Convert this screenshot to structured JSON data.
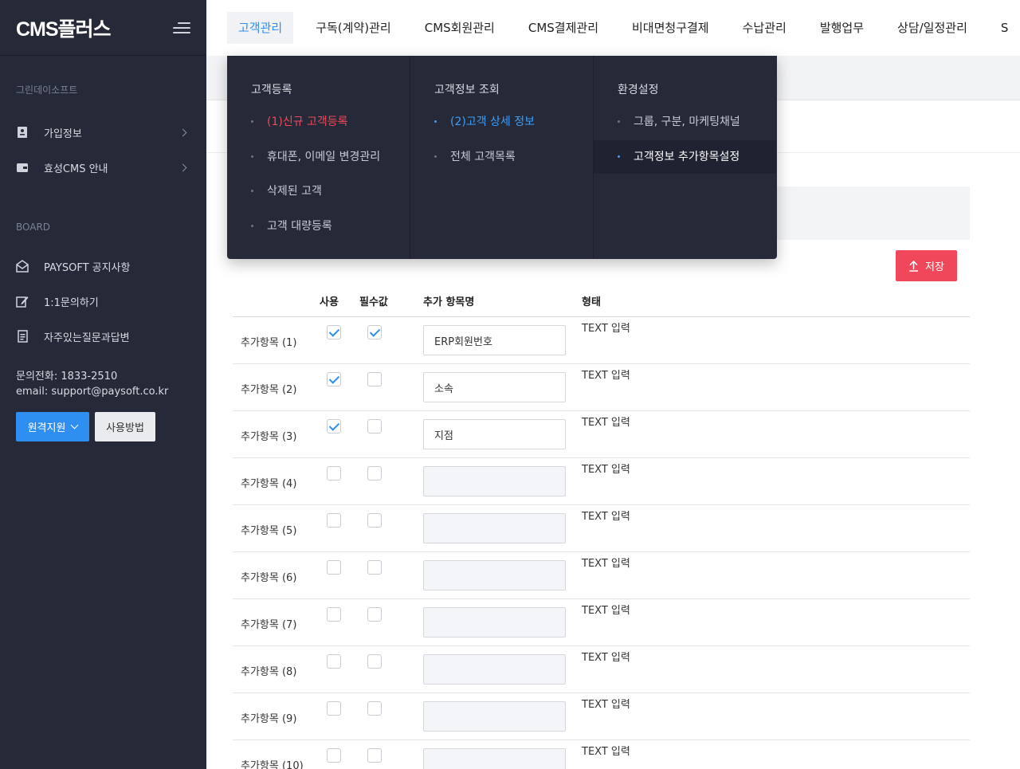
{
  "logo": "CMS플러스",
  "sidebar": {
    "company": "그린데이소프트",
    "menu": [
      {
        "label": "가입정보",
        "icon": "id-card-icon"
      },
      {
        "label": "효성CMS 안내",
        "icon": "wallet-icon"
      }
    ],
    "board_label": "BOARD",
    "board": [
      {
        "label": "PAYSOFT 공지사항",
        "icon": "mail-icon"
      },
      {
        "label": "1:1문의하기",
        "icon": "edit-icon"
      },
      {
        "label": "자주있는질문과답변",
        "icon": "document-icon"
      }
    ],
    "phone": "문의전화: 1833-2510",
    "email": "email: support@paysoft.co.kr",
    "remote_button": "원격지원",
    "usage_button": "사용방법"
  },
  "topnav": [
    "고객관리",
    "구독(계약)관리",
    "CMS회원관리",
    "CMS결제관리",
    "비대면청구결제",
    "수납관리",
    "발행업무",
    "상담/일정관리",
    "S"
  ],
  "mega_menu": {
    "col1": {
      "title": "고객등록",
      "items": [
        "(1)신규 고객등록",
        "휴대폰, 이메일 변경관리",
        "삭제된 고객",
        "고객 대량등록"
      ]
    },
    "col2": {
      "title": "고객정보 조회",
      "items": [
        "(2)고객 상세 정보",
        "전체 고객목록"
      ]
    },
    "col3": {
      "title": "환경설정",
      "items": [
        "그룹, 구분, 마케팅채널",
        "고객정보 추가항목설정"
      ]
    }
  },
  "save_button": "저장",
  "table": {
    "headers": {
      "use": "사용",
      "required": "필수값",
      "name": "추가 항목명",
      "type": "형태"
    },
    "rows": [
      {
        "label": "추가항목 (1)",
        "use": true,
        "required": true,
        "value": "ERP회원번호",
        "type": "TEXT 입력"
      },
      {
        "label": "추가항목 (2)",
        "use": true,
        "required": false,
        "value": "소속",
        "type": "TEXT 입력"
      },
      {
        "label": "추가항목 (3)",
        "use": true,
        "required": false,
        "value": "지점",
        "type": "TEXT 입력"
      },
      {
        "label": "추가항목 (4)",
        "use": false,
        "required": false,
        "value": "",
        "type": "TEXT 입력"
      },
      {
        "label": "추가항목 (5)",
        "use": false,
        "required": false,
        "value": "",
        "type": "TEXT 입력"
      },
      {
        "label": "추가항목 (6)",
        "use": false,
        "required": false,
        "value": "",
        "type": "TEXT 입력"
      },
      {
        "label": "추가항목 (7)",
        "use": false,
        "required": false,
        "value": "",
        "type": "TEXT 입력"
      },
      {
        "label": "추가항목 (8)",
        "use": false,
        "required": false,
        "value": "",
        "type": "TEXT 입력"
      },
      {
        "label": "추가항목 (9)",
        "use": false,
        "required": false,
        "value": "",
        "type": "TEXT 입력"
      },
      {
        "label": "추가항목 (10)",
        "use": false,
        "required": false,
        "value": "",
        "type": "TEXT 입력"
      }
    ]
  }
}
